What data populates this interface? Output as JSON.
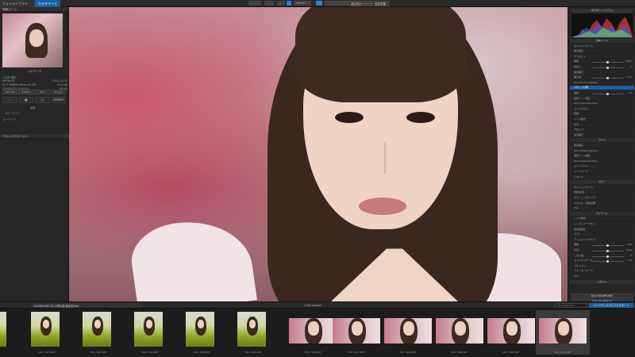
{
  "top_bar": {
    "app_tab": "フォトライブラリ",
    "custom_tab": "カスタマイズ",
    "zoom": "100 %",
    "right_btn1": "補正前のイメージ",
    "right_btn2": "追加書類"
  },
  "left_panel": {
    "navigator_title": "情報/ズーム",
    "metadata_title": "メタデータ",
    "meta": [
      {
        "k": "2 DNP 撮影",
        "v": ""
      },
      {
        "k": "NIKON Z6",
        "v": "5344 x 3712"
      },
      {
        "k": "AF-S NIKKOR 85mm f/1.8G",
        "v": "41.0 MB"
      },
      {
        "k": "2020/03/13 10:44:51",
        "v": "ISO 64"
      }
    ],
    "exif": [
      "ISO 100",
      "1/250 s",
      "f/2.0",
      "85 mm"
    ],
    "icons": [
      "☆",
      "▣",
      "◷",
      "Adobe"
    ],
    "label1": "画像",
    "label2": "コピーライト",
    "label3": "キーワード",
    "asset_head": "アセットマネージャ"
  },
  "right_panel": {
    "hist_btn": "補正後ヒストグラム",
    "rows": [
      {
        "t": "基本ツール",
        "type": "head"
      },
      {
        "t": "ホワイトバランス",
        "v": ""
      },
      {
        "t": "露光補正",
        "v": ""
      },
      {
        "t": "プリセット",
        "v": ""
      },
      {
        "t": "明度",
        "v": "5367"
      },
      {
        "t": "色合い",
        "v": "0"
      },
      {
        "t": "露出補正",
        "v": ""
      },
      {
        "t": "補正値",
        "v": "0.00"
      },
      {
        "t": "DxO Smart Lighting",
        "v": ""
      },
      {
        "t": "スポット計測",
        "type": "blue"
      },
      {
        "t": "強度",
        "v": "25"
      },
      {
        "t": "選択トーン補正",
        "v": ""
      },
      {
        "t": "DxO ClearView Plus",
        "v": ""
      },
      {
        "t": "コントラスト",
        "v": ""
      },
      {
        "t": "色調",
        "v": ""
      },
      {
        "t": "ノイズ除去",
        "v": ""
      },
      {
        "t": "水平",
        "v": ""
      },
      {
        "t": "クロップ",
        "v": ""
      },
      {
        "t": "歪み補正",
        "v": ""
      },
      {
        "t": "ライト",
        "type": "head"
      },
      {
        "t": "露出補正",
        "v": ""
      },
      {
        "t": "DxO Smart Lighting",
        "v": ""
      },
      {
        "t": "選択トーン補正",
        "v": ""
      },
      {
        "t": "DxO ClearView Plus",
        "v": ""
      },
      {
        "t": "コントラスト",
        "v": ""
      },
      {
        "t": "トーンカーブ",
        "v": ""
      },
      {
        "t": "ビネット",
        "v": ""
      },
      {
        "t": "カラー",
        "type": "head"
      },
      {
        "t": "ホワイトバランス",
        "v": ""
      },
      {
        "t": "色相/彩度",
        "v": ""
      },
      {
        "t": "カラーレンダリング",
        "v": ""
      },
      {
        "t": "スタイル - 調色効果",
        "v": ""
      },
      {
        "t": "HSL",
        "v": ""
      },
      {
        "t": "ディテール",
        "type": "head"
      },
      {
        "t": "ノイズ除去",
        "v": ""
      },
      {
        "t": "レンズシャープネス",
        "v": ""
      },
      {
        "t": "色収差補正",
        "v": ""
      },
      {
        "t": "モアレ",
        "v": ""
      },
      {
        "t": "アンシャープマスク",
        "v": ""
      },
      {
        "t": "強度",
        "v": "100"
      },
      {
        "t": "半径",
        "v": "0.50"
      },
      {
        "t": "しきい値",
        "v": "4"
      },
      {
        "t": "エッジディテール",
        "v": "50"
      },
      {
        "t": "ジオメトリ",
        "v": ""
      },
      {
        "t": "ウォーターマーク",
        "v": ""
      },
      {
        "t": "ボケ",
        "v": ""
      },
      {
        "t": "スタイル",
        "type": "head"
      }
    ],
    "plugin1": "DxO VIEWPOINT",
    "plugin2": "DxO FILMPACK"
  },
  "film_bar": {
    "path": "2020年03月13日 大塚公園 撮影会RAW",
    "count": "1,948 images",
    "search": "Nik Collection",
    "export": "ハードディスクにエクスポート"
  },
  "filmstrip": [
    {
      "name": "DSC_7920.NEF",
      "orient": "portrait",
      "flag": "✓"
    },
    {
      "name": "DSC_7921.NEF",
      "orient": "portrait",
      "flag": "✓"
    },
    {
      "name": "DSC_7922.NEF",
      "orient": "portrait",
      "flag": "✓"
    },
    {
      "name": "DSC_7923.NEF",
      "orient": "portrait",
      "flag": "✓"
    },
    {
      "name": "DSC_7924.NEF",
      "orient": "portrait",
      "flag": ""
    },
    {
      "name": "DSC_7925.NEF",
      "orient": "portrait",
      "flag": ""
    },
    {
      "name": "DSC_7926.NEF",
      "orient": "landscape",
      "flag": ""
    },
    {
      "name": "DSC_7927.NEF",
      "orient": "landscape",
      "flag": ""
    },
    {
      "name": "DSC_7928.NEF",
      "orient": "landscape",
      "flag": ""
    },
    {
      "name": "DSC_7929.NEF",
      "orient": "landscape",
      "flag": ""
    },
    {
      "name": "DSC_7930.NEF",
      "orient": "landscape",
      "flag": ""
    },
    {
      "name": "DSC_7931.NEF",
      "orient": "landscape",
      "flag": ""
    }
  ]
}
